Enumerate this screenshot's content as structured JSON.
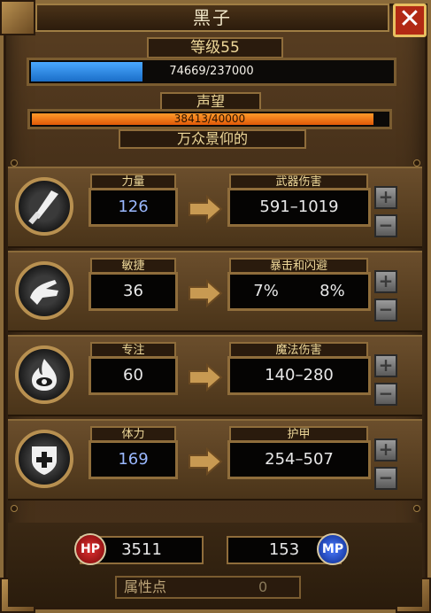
{
  "window": {
    "title": "黑子",
    "close_label": "✕"
  },
  "level": {
    "label": "等级55",
    "xp_text": "74669/237000",
    "xp_progress": 0.315
  },
  "reputation": {
    "label": "声望",
    "value_text": "38413/40000",
    "progress": 0.96,
    "rank": "万众景仰的"
  },
  "stats": [
    {
      "name": "力量",
      "value": "126",
      "effect_label": "武器伤害",
      "effect": "591–1019",
      "icon": "sword-icon"
    },
    {
      "name": "敏捷",
      "value": "36",
      "effect_label": "暴击和闪避",
      "effect_a": "7%",
      "effect_b": "8%",
      "icon": "hand-icon"
    },
    {
      "name": "专注",
      "value": "60",
      "effect_label": "魔法伤害",
      "effect": "140–280",
      "icon": "eye-fire-icon"
    },
    {
      "name": "体力",
      "value": "169",
      "effect_label": "护甲",
      "effect": "254–507",
      "icon": "shield-icon"
    }
  ],
  "plus_label": "+",
  "minus_label": "−",
  "vitals": {
    "hp_label": "HP",
    "hp": "3511",
    "mp_label": "MP",
    "mp": "153"
  },
  "attribute_points": {
    "label": "属性点",
    "value": "0"
  },
  "colors": {
    "xp": "#1a6ec8",
    "reputation": "#e05a08",
    "frame": "#8a6a3a"
  }
}
